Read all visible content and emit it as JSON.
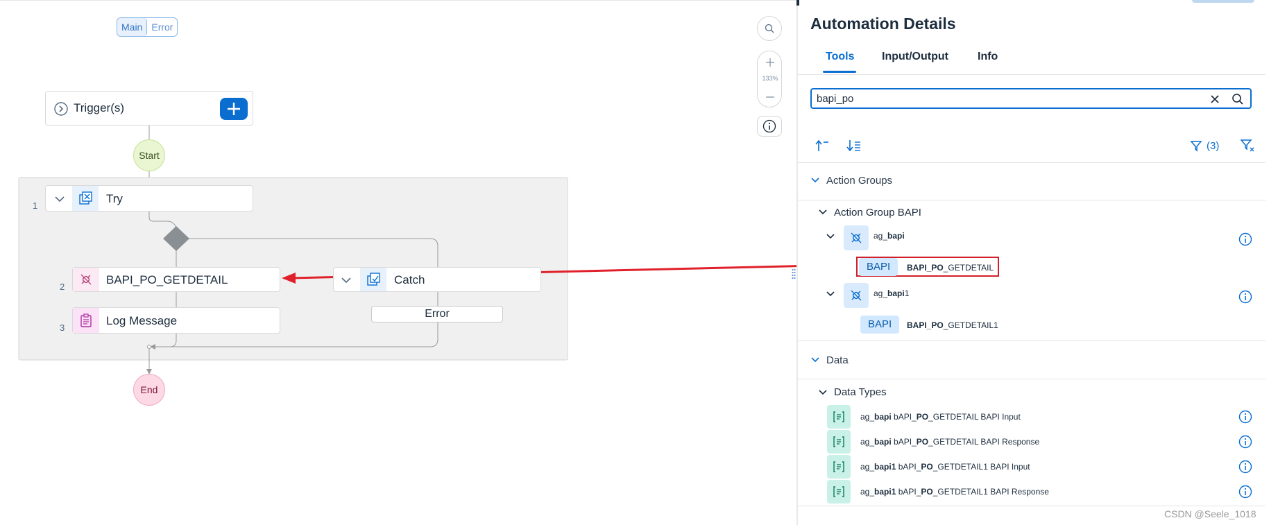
{
  "canvas": {
    "segmented": {
      "main_label": "Main",
      "error_label": "Error"
    },
    "zoom_label": "133%",
    "trigger_label": "Trigger(s)",
    "start_label": "Start",
    "end_label": "End",
    "steps": [
      {
        "number": "1",
        "label": "Try"
      },
      {
        "number": "2",
        "label": "BAPI_PO_GETDETAIL"
      },
      {
        "number": "3",
        "label": "Log Message"
      }
    ],
    "catch_label": "Catch",
    "error_box_label": "Error"
  },
  "panel": {
    "title": "Automation Details",
    "tabs": [
      "Tools",
      "Input/Output",
      "Info"
    ],
    "search": {
      "value": "bapi_po"
    },
    "filter_count": "(3)",
    "sections": {
      "action_groups": "Action Groups",
      "action_group_bapi": "Action Group BAPI",
      "data": "Data",
      "data_types": "Data Types"
    },
    "action_groups": [
      {
        "name_bold": "",
        "name_prefix": "ag_",
        "name_match": "bapi",
        "name_suffix": "",
        "badge": "BAPI",
        "action_match": "BAPI_PO",
        "action_rest": "_GETDETAIL"
      },
      {
        "name_prefix": "ag_",
        "name_match": "bapi",
        "name_suffix": "1",
        "badge": "BAPI",
        "action_match": "BAPI_PO",
        "action_rest": "_GETDETAIL1"
      }
    ],
    "data_types": [
      {
        "p1": "ag_",
        "b1": "bapi",
        "p2": " bAPI_",
        "b2": "PO",
        "p3": "_GETDETAIL BAPI Input"
      },
      {
        "p1": "ag_",
        "b1": "bapi",
        "p2": " bAPI_",
        "b2": "PO",
        "p3": "_GETDETAIL BAPI Response"
      },
      {
        "p1": "ag_",
        "b1": "bapi1",
        "p2": " bAPI_",
        "b2": "PO",
        "p3": "_GETDETAIL1 BAPI Input"
      },
      {
        "p1": "ag_",
        "b1": "bapi1",
        "p2": " bAPI_",
        "b2": "PO",
        "p3": "_GETDETAIL1 BAPI Response"
      }
    ]
  },
  "watermark": "CSDN @Seele_1018",
  "colors": {
    "accent": "#0a6ed1",
    "arrow": "#e0202a",
    "highlight_border": "#d0202a"
  }
}
